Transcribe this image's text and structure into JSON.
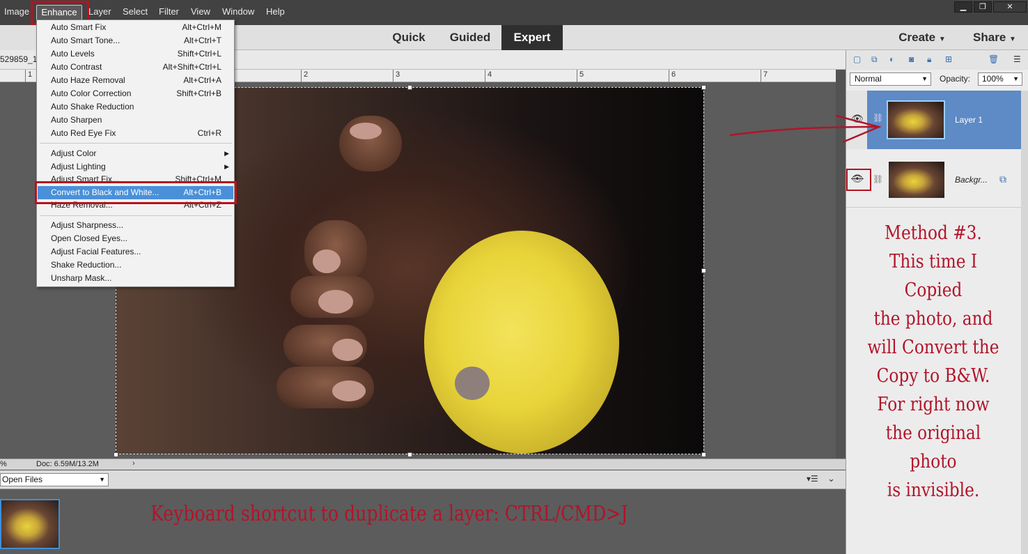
{
  "menubar": {
    "items": [
      "Image",
      "Enhance",
      "Layer",
      "Select",
      "Filter",
      "View",
      "Window",
      "Help"
    ],
    "window_controls": {
      "minimize": "▁",
      "restore": "❐",
      "close": "✕"
    }
  },
  "modebar": {
    "tabs": [
      "Quick",
      "Guided",
      "Expert"
    ],
    "create_label": "Create",
    "share_label": "Share"
  },
  "document": {
    "tab_label": "529859_1",
    "ruler_numbers": [
      "1",
      "2",
      "3",
      "4",
      "5",
      "6",
      "7"
    ],
    "zoom_fragment": "%",
    "doc_info": "Doc: 6.59M/13.2M"
  },
  "enhance_menu": {
    "items": [
      {
        "label": "Auto Smart Fix",
        "shortcut": "Alt+Ctrl+M"
      },
      {
        "label": "Auto Smart Tone...",
        "shortcut": "Alt+Ctrl+T"
      },
      {
        "label": "Auto Levels",
        "shortcut": "Shift+Ctrl+L"
      },
      {
        "label": "Auto Contrast",
        "shortcut": "Alt+Shift+Ctrl+L"
      },
      {
        "label": "Auto Haze Removal",
        "shortcut": "Alt+Ctrl+A"
      },
      {
        "label": "Auto Color Correction",
        "shortcut": "Shift+Ctrl+B"
      },
      {
        "label": "Auto Shake Reduction",
        "shortcut": ""
      },
      {
        "label": "Auto Sharpen",
        "shortcut": ""
      },
      {
        "label": "Auto Red Eye Fix",
        "shortcut": "Ctrl+R"
      },
      {
        "label": "Adjust Color",
        "shortcut": ""
      },
      {
        "label": "Adjust Lighting",
        "shortcut": ""
      },
      {
        "label": "Adjust Smart Fix...",
        "shortcut": "Shift+Ctrl+M"
      },
      {
        "label": "Convert to Black and White...",
        "shortcut": "Alt+Ctrl+B"
      },
      {
        "label": "Haze Removal...",
        "shortcut": "Alt+Ctrl+Z"
      },
      {
        "label": "Adjust Sharpness...",
        "shortcut": ""
      },
      {
        "label": "Open Closed Eyes...",
        "shortcut": ""
      },
      {
        "label": "Adjust Facial Features...",
        "shortcut": ""
      },
      {
        "label": "Shake Reduction...",
        "shortcut": ""
      },
      {
        "label": "Unsharp Mask...",
        "shortcut": ""
      }
    ]
  },
  "photo_bin": {
    "dropdown_value": "Open Files"
  },
  "layers_panel": {
    "blend_mode": "Normal",
    "opacity_label": "Opacity:",
    "opacity_value": "100%",
    "layers": [
      {
        "name": "Layer 1",
        "visible": true,
        "selected": true
      },
      {
        "name": "Backgr...",
        "visible": false,
        "selected": false
      }
    ]
  },
  "annotations": {
    "method_note": "Method #3.\nThis time I Copied\nthe photo, and\nwill Convert the\nCopy to B&W.\nFor right now\nthe original photo\nis invisible.",
    "shortcut_note": "Keyboard shortcut to duplicate a layer: CTRL/CMD>J",
    "color": "#b1142a"
  },
  "colors": {
    "selection_blue": "#4a90d9",
    "layer_selected": "#5e8ac5",
    "highlight_red": "#b6121f"
  }
}
